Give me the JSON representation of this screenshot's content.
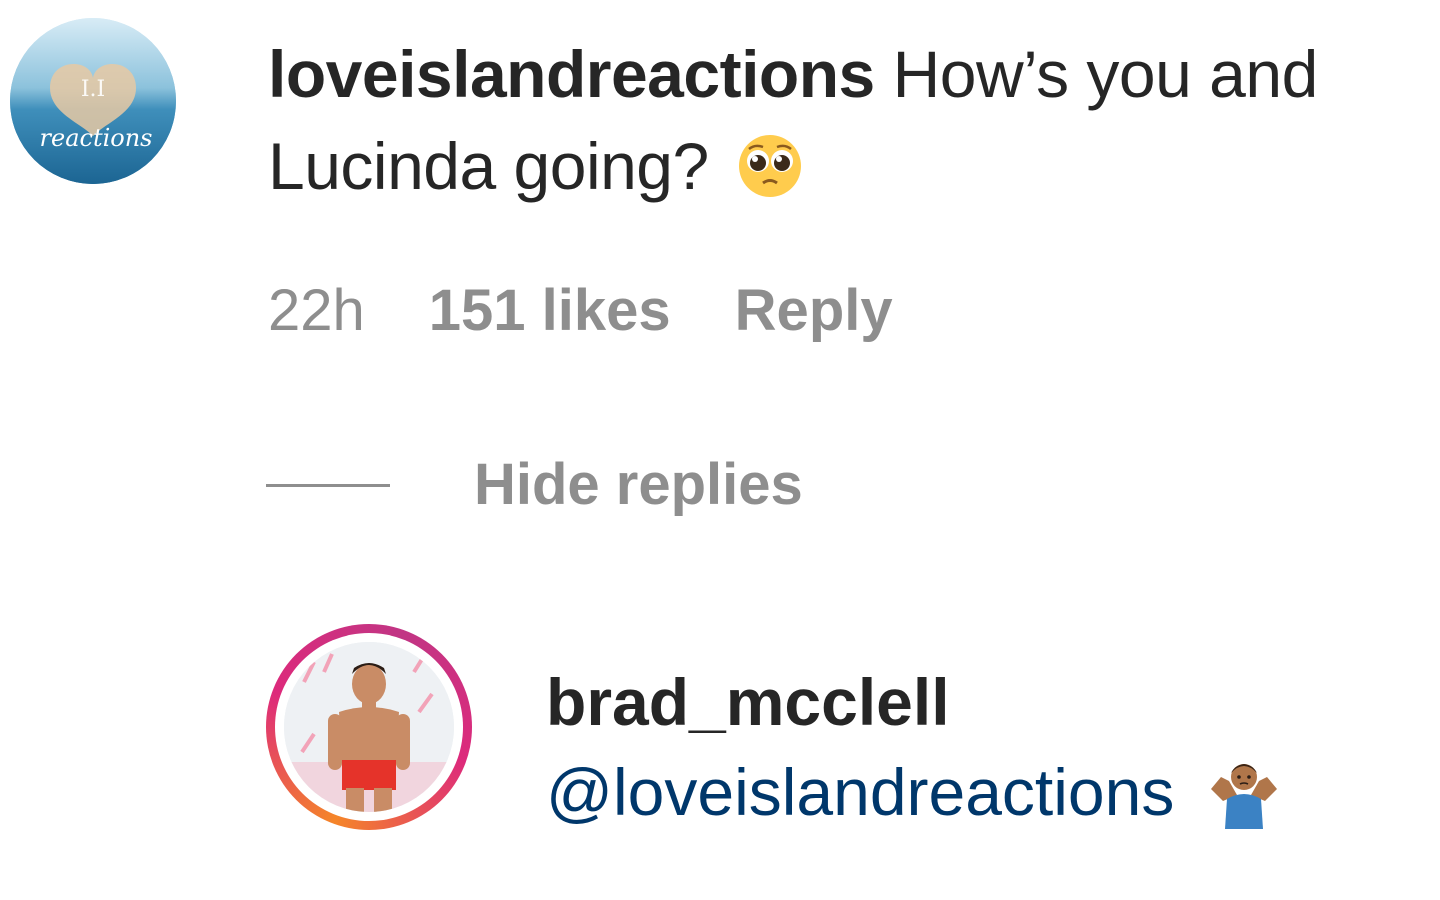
{
  "comment": {
    "username": "loveislandreactions",
    "text": "How’s you and Lucinda going?",
    "emoji": "pleading-face-icon",
    "time": "22h",
    "likes": "151 likes",
    "reply_label": "Reply"
  },
  "thread": {
    "hide_replies_label": "Hide replies"
  },
  "reply": {
    "username": "brad_mcclell",
    "mention": "@loveislandreactions",
    "emoji": "person-shrugging-icon"
  },
  "colors": {
    "text_primary": "#262626",
    "text_secondary": "#8e8e8e",
    "mention": "#00376b",
    "story_ring_start": "#f58529",
    "story_ring_end": "#dd2a7b"
  }
}
